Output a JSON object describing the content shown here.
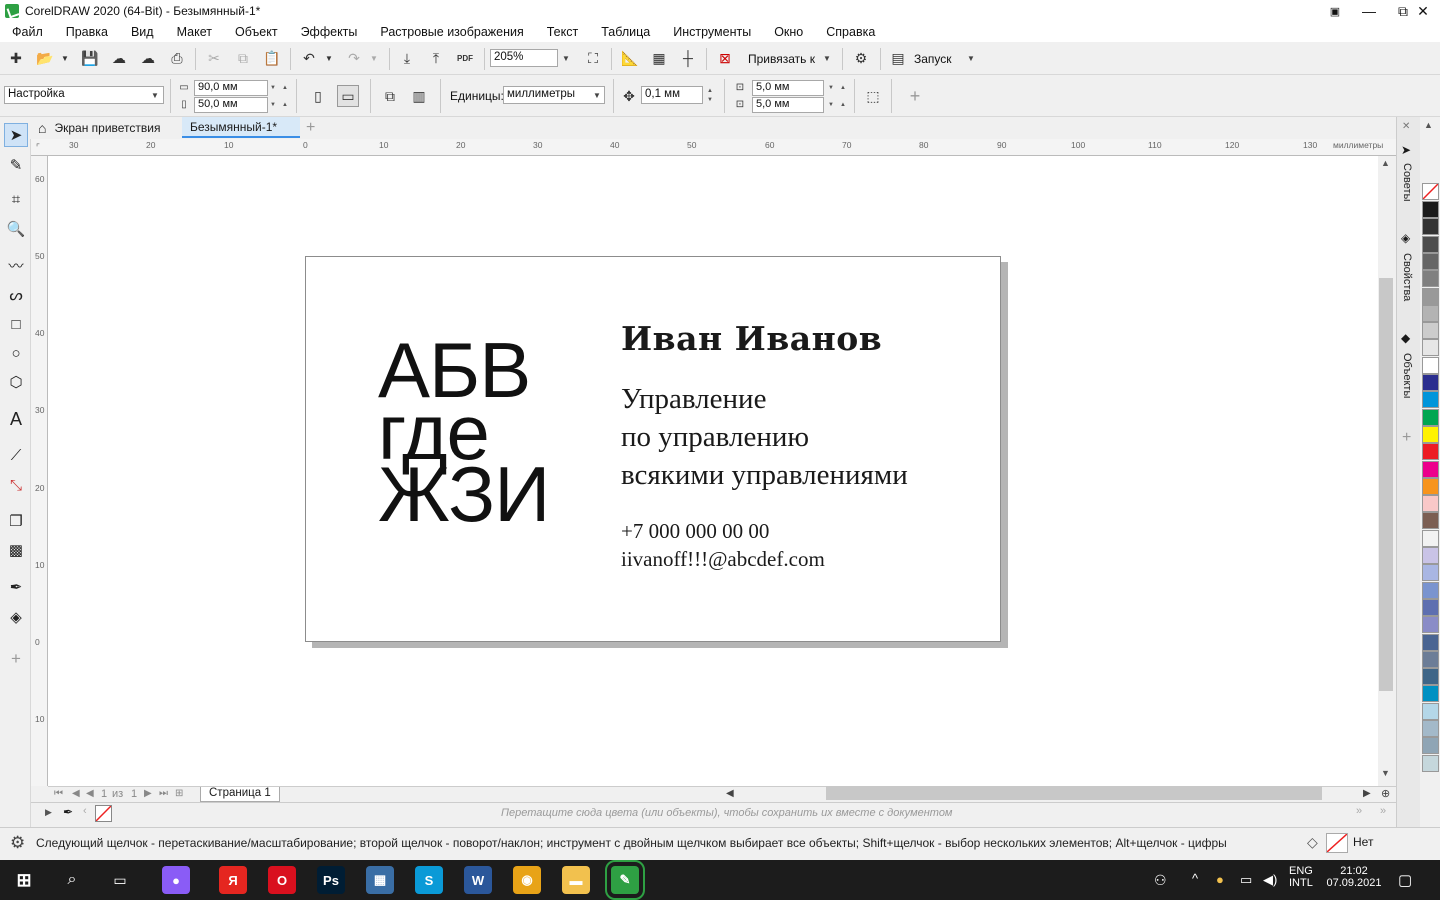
{
  "window": {
    "title": "CorelDRAW 2020 (64-Bit) - Безымянный-1*",
    "min": "—",
    "restore": "⧉",
    "close": "✕"
  },
  "menu": [
    "Файл",
    "Правка",
    "Вид",
    "Макет",
    "Объект",
    "Эффекты",
    "Растровые изображения",
    "Текст",
    "Таблица",
    "Инструменты",
    "Окно",
    "Справка"
  ],
  "toolbar": {
    "pdf": "PDF",
    "zoom": "205%",
    "snap_label": "Привязать к",
    "launch_label": "Запуск"
  },
  "property_bar": {
    "preset": "Настройка",
    "width": "90,0 мм",
    "height": "50,0 мм",
    "units_label": "Единицы:",
    "units": "миллиметры",
    "nudge": "0,1 мм",
    "dup_x": "5,0 мм",
    "dup_y": "5,0 мм",
    "add": "+"
  },
  "doc_tabs": {
    "welcome": "Экран приветствия",
    "document": "Безымянный-1*",
    "add": "+"
  },
  "ruler": {
    "unit": "миллиметры",
    "h_ticks": [
      "30",
      "20",
      "10",
      "0",
      "10",
      "20",
      "30",
      "40",
      "50",
      "60",
      "70",
      "80",
      "90",
      "100",
      "110",
      "120",
      "130"
    ],
    "v_ticks": [
      "60",
      "50",
      "40",
      "30",
      "20",
      "10",
      "0",
      "10"
    ]
  },
  "card": {
    "logo_lines": [
      "АБВ",
      "где",
      "ЖЗИ"
    ],
    "name": "Иван Иванов",
    "position_lines": [
      "Управление",
      "по управлению",
      "всякими управлениями"
    ],
    "phone": "+7 000 000 00 00",
    "email": "iivanoff!!!@abcdef.com"
  },
  "page_nav": {
    "current": "1",
    "of": "из",
    "total": "1",
    "page_tab": "Страница 1"
  },
  "color_tray": {
    "hint": "Перетащите сюда цвета (или объекты), чтобы сохранить их вместе с документом"
  },
  "docker_tabs": [
    "Советы",
    "Свойства",
    "Объекты"
  ],
  "palette": [
    "#1a1a1a",
    "#333333",
    "#4d4d4d",
    "#666666",
    "#808080",
    "#999999",
    "#b3b3b3",
    "#cccccc",
    "#e6e6e6",
    "#ffffff",
    "#2b2e8f",
    "#0095da",
    "#00a651",
    "#fff200",
    "#ed1c24",
    "#ec008c",
    "#f7941d",
    "#f9c8c8",
    "#7b5e52",
    "#f2f2f2",
    "#c9c3e6",
    "#a9b6e3",
    "#7a94cf",
    "#5e6fb0",
    "#8a8cc7",
    "#4a6592",
    "#6c7d97",
    "#3f6688",
    "#0091c2",
    "#b4d7e8",
    "#a3b9c9",
    "#8fa5b5",
    "#c5d7dc"
  ],
  "status": {
    "text": "Следующий щелчок - перетаскивание/масштабирование; второй щелчок - поворот/наклон; инструмент с двойным щелчком выбирает все объекты; Shift+щелчок - выбор нескольких элементов; Alt+щелчок - цифры",
    "fill_none": "Нет"
  },
  "taskbar": {
    "lang1": "ENG",
    "lang2": "INTL",
    "time": "21:02",
    "date": "07.09.2021",
    "apps": [
      {
        "name": "alice",
        "color": "#8a5cf6",
        "glyph": "●"
      },
      {
        "name": "yandex",
        "color": "#e52620",
        "glyph": "Я"
      },
      {
        "name": "opera",
        "color": "#d9101e",
        "glyph": "O"
      },
      {
        "name": "photoshop",
        "color": "#001d34",
        "glyph": "Ps"
      },
      {
        "name": "viewer",
        "color": "#3a6ea5",
        "glyph": "▦"
      },
      {
        "name": "skype",
        "color": "#0a9ad7",
        "glyph": "S"
      },
      {
        "name": "word",
        "color": "#2b579a",
        "glyph": "W"
      },
      {
        "name": "chrome",
        "color": "#e8a317",
        "glyph": "◉"
      },
      {
        "name": "explorer",
        "color": "#f2c14e",
        "glyph": "▬"
      },
      {
        "name": "coreldraw",
        "color": "#2ea043",
        "glyph": "✎"
      }
    ]
  }
}
